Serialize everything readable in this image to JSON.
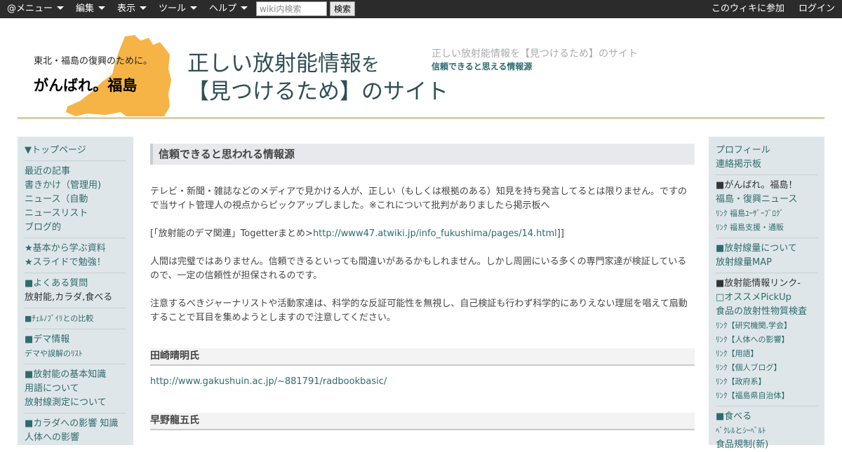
{
  "topbar": {
    "menus": [
      "@メニュー",
      "編集",
      "表示",
      "ツール",
      "ヘルプ"
    ],
    "search_placeholder": "wiki内検索",
    "search_button": "検索",
    "join": "このウィキに参加",
    "login": "ログイン"
  },
  "header": {
    "logo_line1": "東北・福島の復興のために。",
    "logo_line2": "がんばれ。福島",
    "title_line1_a": "正しい放射能情報",
    "title_line1_b": "を",
    "title_line2": "【見つけるため】のサイト",
    "sub_title": "正しい放射能情報を【見つけるため】のサイト",
    "sub_link": "信頼できると思える情報源"
  },
  "left_sidebar": [
    {
      "label": "▼トップページ",
      "link": true
    },
    {
      "sep": true
    },
    {
      "label": "最近の記事",
      "link": true
    },
    {
      "label": "書きかけ（管理用)",
      "link": true
    },
    {
      "label": "ニュース（自動",
      "link": true
    },
    {
      "label": "ニュースリスト",
      "link": true
    },
    {
      "label": "ブログ的",
      "link": true
    },
    {
      "sep": true
    },
    {
      "label": "★基本から学ぶ資料",
      "link": true
    },
    {
      "label": "★スライドで勉強！",
      "link": true
    },
    {
      "sep": true
    },
    {
      "label": "■よくある質問",
      "link": true
    },
    {
      "label": "放射能,カラダ,食べる",
      "link": false
    },
    {
      "sep": true
    },
    {
      "label": "■ﾁｪﾙﾉﾌﾞｲﾘとの比較",
      "link": true
    },
    {
      "sep": true
    },
    {
      "label": "■デマ情報",
      "link": true
    },
    {
      "label": "デマや誤解のﾘｽﾄ",
      "link": true
    },
    {
      "sep": true
    },
    {
      "label": "■放射能の基本知識",
      "link": true
    },
    {
      "label": "用語について",
      "link": true
    },
    {
      "label": "放射線測定について",
      "link": true
    },
    {
      "sep": true
    },
    {
      "label": "■カラダへの影響 知識",
      "link": true
    },
    {
      "label": "人体への影響",
      "link": true
    }
  ],
  "right_sidebar": [
    {
      "label": "プロフィール",
      "link": true
    },
    {
      "label": "連絡掲示板",
      "link": true
    },
    {
      "sep": true
    },
    {
      "label": "■がんばれ。福島！",
      "link": false
    },
    {
      "label": "福島・復興ニュース",
      "link": true
    },
    {
      "label": "ﾘﾝｸ 福島ﾕｰｻﾞｰﾌﾞﾛｸﾞ",
      "link": true
    },
    {
      "label": "ﾘﾝｸ 福島支援・通販",
      "link": true
    },
    {
      "sep": true
    },
    {
      "label": "■放射線量について",
      "link": true
    },
    {
      "label": "放射線量MAP",
      "link": true
    },
    {
      "sep": true
    },
    {
      "label": "■放射能情報リンク-",
      "link": false
    },
    {
      "label": "□オススメPickUp",
      "link": true
    },
    {
      "label": "食品の放射性物質検査",
      "link": true
    },
    {
      "label": "ﾘﾝｸ【研究機関,学会】",
      "link": true
    },
    {
      "label": "ﾘﾝｸ【人体への影響】",
      "link": true
    },
    {
      "label": "ﾘﾝｸ【用語】",
      "link": true
    },
    {
      "label": "ﾘﾝｸ【個人ブログ】",
      "link": true
    },
    {
      "label": "ﾘﾝｸ【政府系】",
      "link": true
    },
    {
      "label": "ﾘﾝｸ【福島県自治体】",
      "link": true
    },
    {
      "sep": true
    },
    {
      "label": "■食べる",
      "link": true
    },
    {
      "label": "ﾍﾞｸﾚﾙとｼｰﾍﾞﾙﾄ",
      "link": true
    },
    {
      "label": "食品規制(新)",
      "link": true
    }
  ],
  "main": {
    "heading": "信頼できると思われる情報源",
    "para1": "テレビ・新聞・雑誌などのメディアで見かける人が、正しい（もしくは根拠のある）知見を持ち発言してるとは限りません。ですので当サイト管理人の視点からピックアップしました。※これについて批判がありましたら掲示板へ",
    "para2_prefix": "[「放射能のデマ関連」Togetterまとめ>",
    "para2_link": "http://www47.atwiki.jp/info_fukushima/pages/14.html",
    "para2_suffix": "]]",
    "para3": "人間は完璧ではありません。信頼できるといっても間違いがあるかもしれません。しかし周囲にいる多くの専門家達が検証しているので、一定の信頼性が担保されるのです。",
    "para4": "注意するべきジャーナリストや活動家達は、科学的な反証可能性を無視し、自己検証も行わず科学的にありえない理屈を唱えて扇動することで耳目を集めようとしますので注意してください。",
    "person1": "田崎晴明氏",
    "person1_link": "http://www.gakushuin.ac.jp/~881791/radbookbasic/",
    "person2": "早野龍五氏"
  }
}
